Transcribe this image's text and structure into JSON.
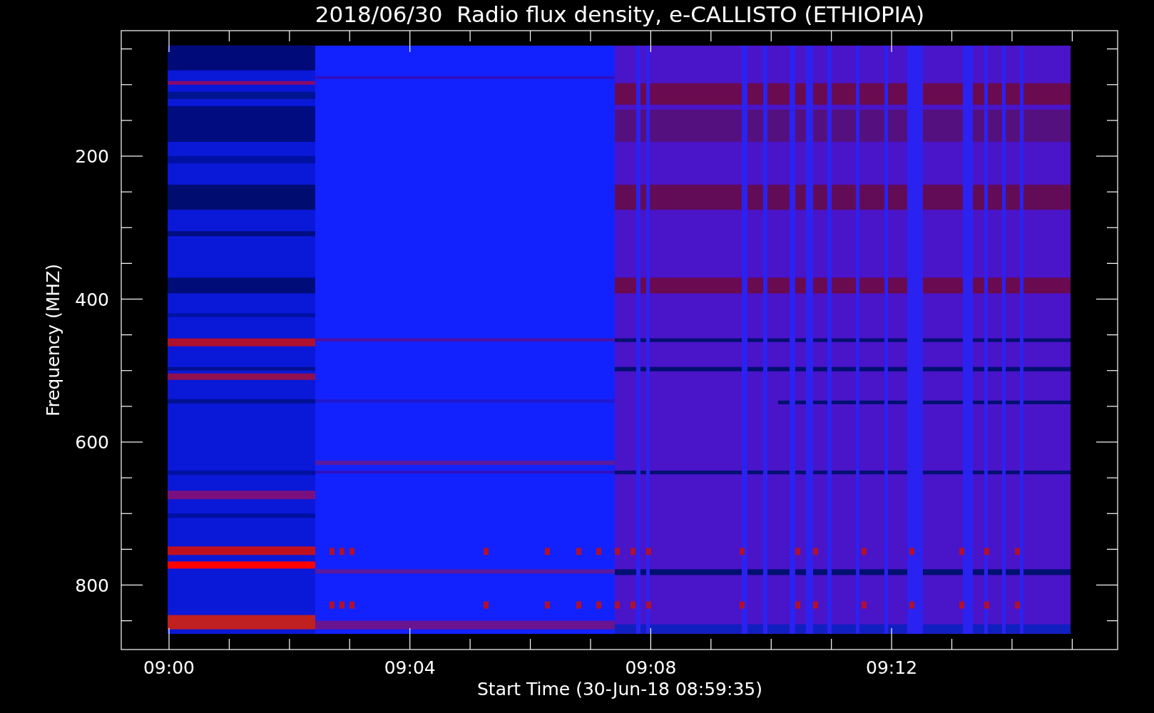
{
  "title": "2018/06/30  Radio flux density, e-CALLISTO (ETHIOPIA)",
  "plot": {
    "ylabel": "Frequency (MHZ)",
    "xlabel": "Start Time (30-Jun-18 08:59:35)",
    "yticks": [
      "200",
      "400",
      "600",
      "800"
    ],
    "xticks": [
      "09:00",
      "09:04",
      "09:08",
      "09:12"
    ]
  }
}
